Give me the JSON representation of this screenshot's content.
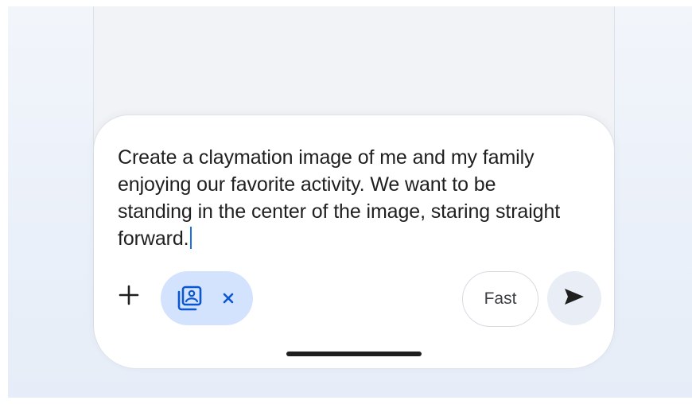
{
  "composer": {
    "prompt_text": "Create a claymation image of me and my family enjoying our favorite activity. We want to be standing in the center of the image, staring straight forward.",
    "add_icon": "plus-icon",
    "attachment_chip": {
      "icon": "photo-library-icon",
      "close_icon": "close-icon"
    },
    "mode_label": "Fast",
    "send_icon": "send-icon"
  },
  "colors": {
    "chip_background": "#d3e3fd",
    "chip_icon": "#0b57d0",
    "caret": "#1a73e8",
    "send_button_background": "#e9eef6"
  }
}
